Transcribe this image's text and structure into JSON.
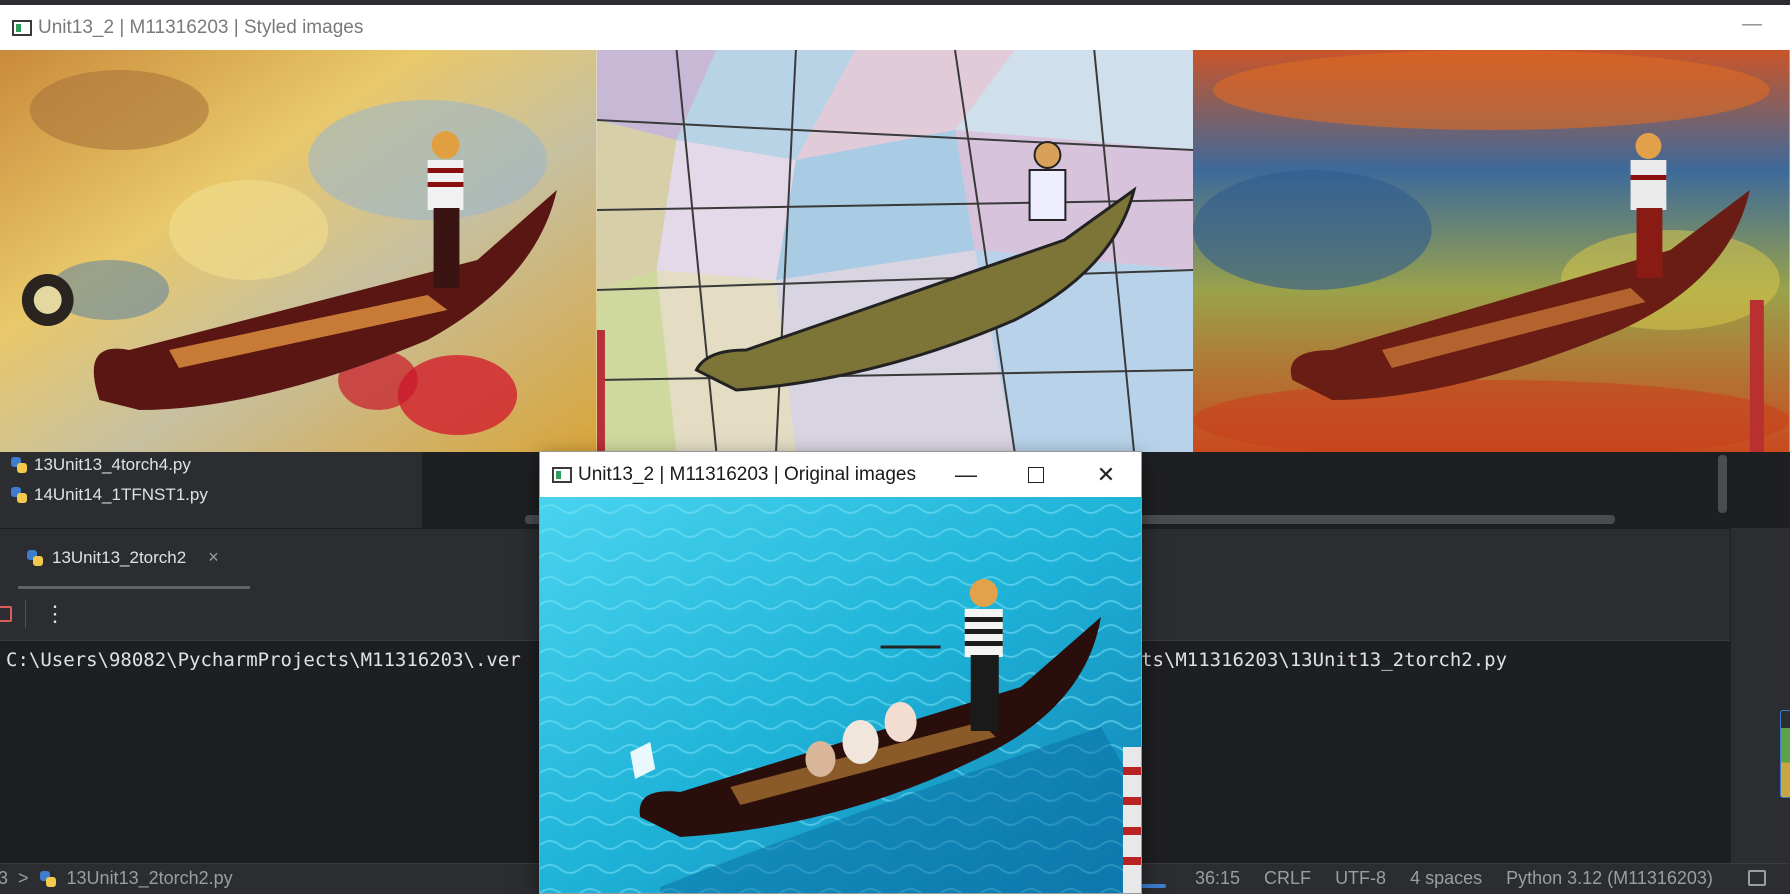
{
  "styled_window": {
    "title": "Unit13_2 | M11316203 | Styled images",
    "minimize_glyph": "—"
  },
  "original_window": {
    "title": "Unit13_2 | M11316203 | Original images",
    "minimize_glyph": "—",
    "close_glyph": "✕"
  },
  "project_tree": {
    "items": [
      {
        "label": "13Unit13_4torch4.py",
        "icon": "python-file-icon"
      },
      {
        "label": "14Unit14_1TFNST1.py",
        "icon": "python-file-icon"
      }
    ]
  },
  "run_panel": {
    "tab_label": "13Unit13_2torch2",
    "tab_close": "×",
    "kebab": "⋮",
    "console_left": "C:\\Users\\98082\\PycharmProjects\\M11316203\\.ver",
    "console_right": "ts\\M11316203\\13Unit13_2torch2.py"
  },
  "status_bar": {
    "breadcrumb_prefix": "3",
    "chevron": ">",
    "file": "13Unit13_2torch2.py",
    "position": "36:15",
    "line_ending": "CRLF",
    "encoding": "UTF-8",
    "indent": "4 spaces",
    "interpreter": "Python 3.12 (M11316203)"
  },
  "colors": {
    "ide_bg": "#1e1f22",
    "ide_panel": "#2b2d30",
    "water": "#1fb3d8",
    "gondola": "#4a1410"
  }
}
